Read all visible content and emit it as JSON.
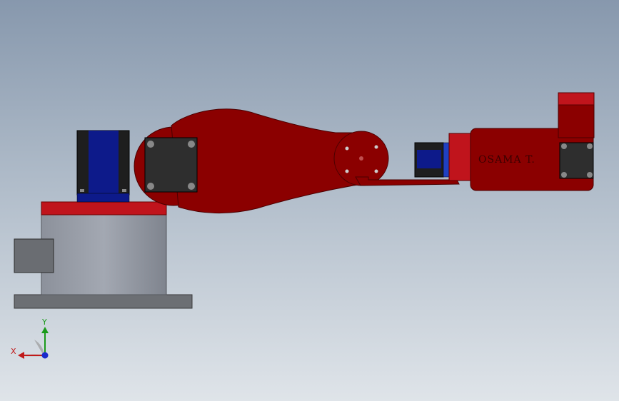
{
  "model": {
    "brand_text": "OSAMA T."
  },
  "triad": {
    "x_label": "X",
    "y_label": "Y"
  },
  "colors": {
    "background_top": "#8798ad",
    "background_bottom": "#dfe4e9",
    "arm_red": "#8b0000",
    "accent_red": "#c0141c",
    "motor_blue": "#0d1a8a",
    "base_gray": "#9aa0ab",
    "plate_gray": "#6c6f74",
    "servo_dark": "#2e2e2e"
  }
}
